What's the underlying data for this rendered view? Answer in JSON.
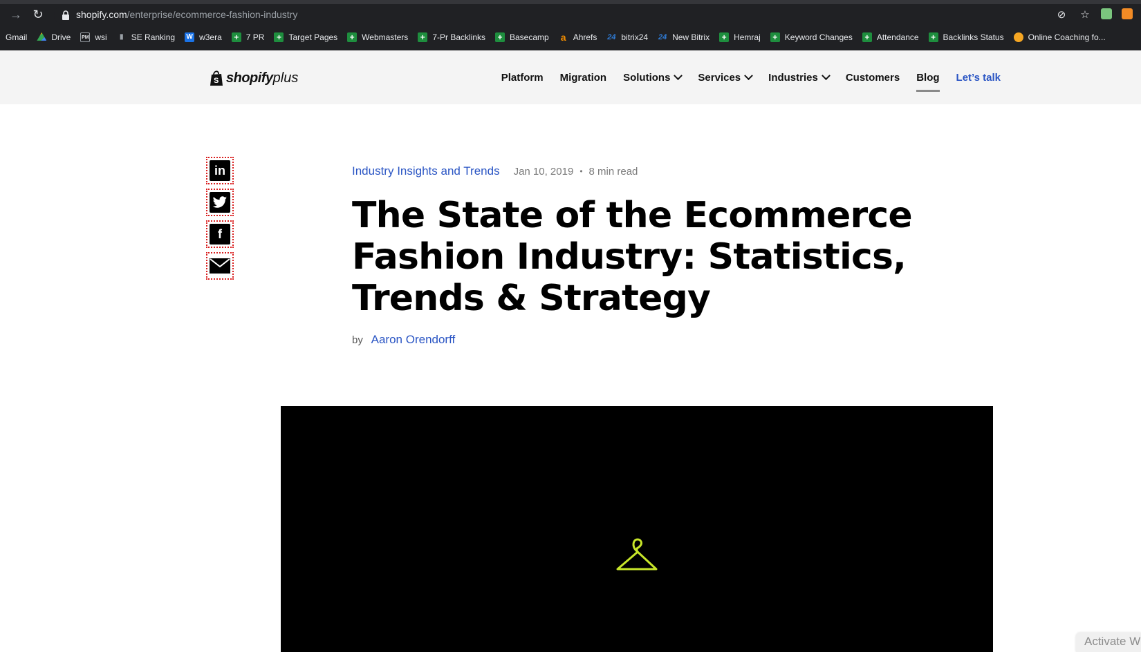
{
  "browser": {
    "url_host": "shopify.com",
    "url_path": "/enterprise/ecommerce-fashion-industry",
    "icons": [
      "back-arrow-icon",
      "reload-icon",
      "lock-icon",
      "eye-off-icon",
      "star-icon"
    ],
    "bookmarks": [
      {
        "label": "Gmail",
        "icon": "none"
      },
      {
        "label": "Drive",
        "icon": "drive"
      },
      {
        "label": "wsi",
        "icon": "pm"
      },
      {
        "label": "SE Ranking",
        "icon": "bars"
      },
      {
        "label": "w3era",
        "icon": "w"
      },
      {
        "label": "7 PR",
        "icon": "green"
      },
      {
        "label": "Target Pages",
        "icon": "green"
      },
      {
        "label": "Webmasters",
        "icon": "green"
      },
      {
        "label": "7-Pr Backlinks",
        "icon": "green"
      },
      {
        "label": "Basecamp",
        "icon": "green"
      },
      {
        "label": "Ahrefs",
        "icon": "a"
      },
      {
        "label": "bitrix24",
        "icon": "b24"
      },
      {
        "label": "New Bitrix",
        "icon": "b24"
      },
      {
        "label": "Hemraj",
        "icon": "green"
      },
      {
        "label": "Keyword Changes",
        "icon": "green"
      },
      {
        "label": "Attendance",
        "icon": "green"
      },
      {
        "label": "Backlinks Status",
        "icon": "green"
      },
      {
        "label": "Online Coaching fo...",
        "icon": "coach"
      }
    ]
  },
  "header": {
    "logo_text": "shopify",
    "logo_plus": "plus",
    "nav": [
      {
        "label": "Platform",
        "dropdown": false
      },
      {
        "label": "Migration",
        "dropdown": false
      },
      {
        "label": "Solutions",
        "dropdown": true
      },
      {
        "label": "Services",
        "dropdown": true
      },
      {
        "label": "Industries",
        "dropdown": true
      },
      {
        "label": "Customers",
        "dropdown": false
      },
      {
        "label": "Blog",
        "dropdown": false,
        "active": true
      }
    ],
    "cta": "Let’s talk"
  },
  "share": {
    "buttons": [
      "linkedin",
      "twitter",
      "facebook",
      "email"
    ],
    "linkedin_glyph": "in",
    "facebook_glyph": "f"
  },
  "article": {
    "category": "Industry Insights and Trends",
    "date": "Jan 10, 2019",
    "separator": "•",
    "read_time": "8 min read",
    "title": "The State of the Ecommerce Fashion Industry: Statistics, Trends & Strategy",
    "by": "by",
    "author": "Aaron Orendorff"
  },
  "hero": {
    "background": "#000000",
    "icon": "hanger-icon",
    "icon_color": "#c8e62a"
  },
  "os_overlay": {
    "text": "Activate W"
  },
  "colors": {
    "accent": "#2a55c4",
    "chrome": "#202124",
    "header_bg": "#f4f4f4",
    "share_outline": "#d92020"
  }
}
